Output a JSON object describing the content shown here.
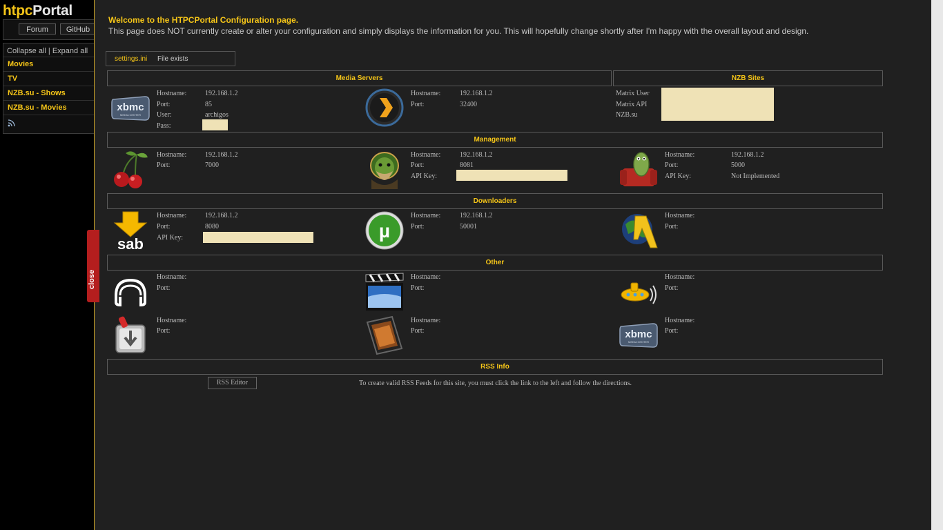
{
  "logo": {
    "part1": "htpc",
    "part2": "Portal"
  },
  "nav": {
    "forum": "Forum",
    "github": "GitHub"
  },
  "sidebar": {
    "collapse": "Collapse all | Expand all",
    "items": [
      "Movies",
      "TV",
      "NZB.su - Shows",
      "NZB.su - Movies"
    ]
  },
  "close_tab": "close",
  "welcome": "Welcome to the HTPCPortal Configuration page.",
  "description": "This page does NOT currently create or alter your configuration and simply displays the information for you. This will hopefully change shortly after I'm happy with the overall layout and design.",
  "settings": {
    "name": "settings.ini",
    "status": "File exists"
  },
  "sections": {
    "media_servers": "Media Servers",
    "nzb_sites": "NZB Sites",
    "management": "Management",
    "downloaders": "Downloaders",
    "other": "Other",
    "rss_info": "RSS Info"
  },
  "labels": {
    "hostname": "Hostname:",
    "port": "Port:",
    "user": "User:",
    "pass": "Pass:",
    "api_key": "API Key:"
  },
  "xbmc": {
    "hostname": "192.168.1.2",
    "port": "85",
    "user": "archigos"
  },
  "plex": {
    "hostname": "192.168.1.2",
    "port": "32400"
  },
  "nzb_sites": [
    "Matrix User",
    "Matrix API",
    "NZB.su"
  ],
  "couchpotato": {
    "hostname": "192.168.1.2",
    "port": "7000"
  },
  "sickbeard": {
    "hostname": "192.168.1.2",
    "port": "8081"
  },
  "mediafront": {
    "hostname": "192.168.1.2",
    "port": "5000",
    "api_key": "Not Implemented"
  },
  "sabnzbd": {
    "hostname": "192.168.1.2",
    "port": "8080"
  },
  "utorrent": {
    "hostname": "192.168.1.2",
    "port": "50001"
  },
  "rss": {
    "button": "RSS Editor",
    "message": "To create valid RSS Feeds for this site, you must click the link to the left and follow the directions."
  },
  "colors": {
    "accent": "#f5c518",
    "background": "#202020",
    "redacted": "#efe2b6",
    "close_tab": "#b41e1e"
  }
}
